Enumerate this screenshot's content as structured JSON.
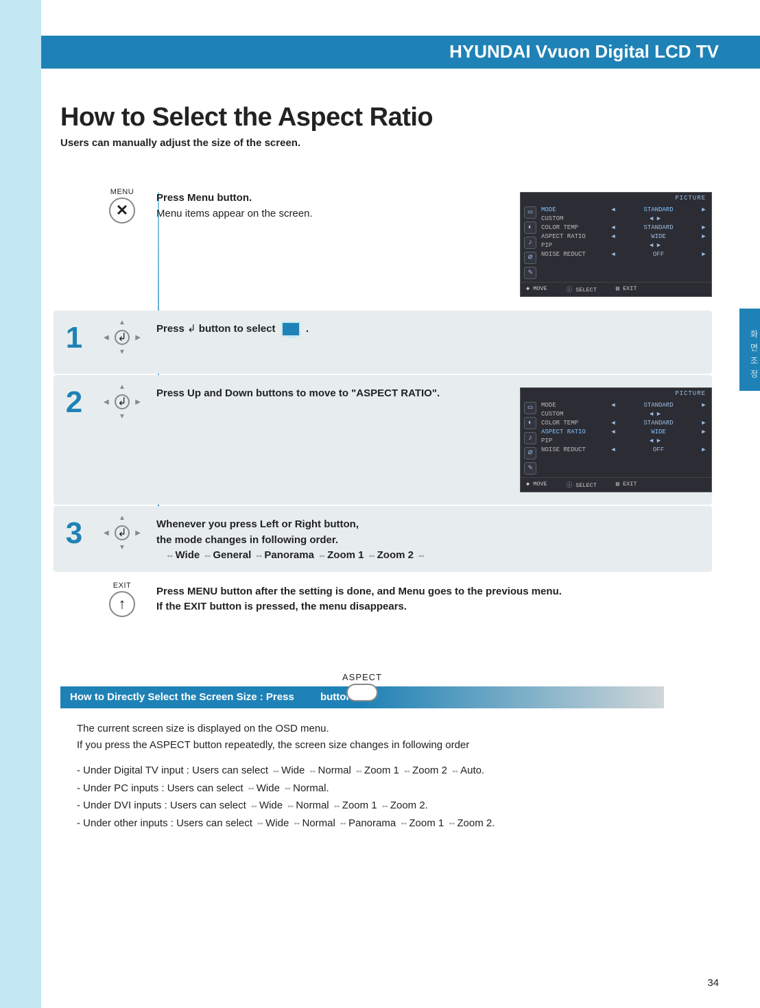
{
  "header": {
    "title": "HYUNDAI Vvuon Digital LCD TV"
  },
  "page_title": "How to Select the Aspect Ratio",
  "page_subtitle": "Users can manually adjust the size of the screen.",
  "side_tab": "화 면 조 정",
  "steps": {
    "menu": {
      "icon_label": "MENU",
      "line1": "Press Menu button.",
      "line2": "Menu items appear on the screen."
    },
    "s1": {
      "num": "1",
      "text_pre": "Press ",
      "text_mid": " button to select ",
      "text_post": " ."
    },
    "s2": {
      "num": "2",
      "text": "Press Up and Down buttons to move to  \"ASPECT RATIO\"."
    },
    "s3": {
      "num": "3",
      "line1": "Whenever you press Left or Right button,",
      "line2": "the mode changes in following order.",
      "modes": [
        "Wide",
        "General",
        "Panorama",
        "Zoom 1",
        "Zoom 2"
      ]
    },
    "exit": {
      "icon_label": "EXIT",
      "line1": "Press MENU button after the setting is done, and Menu goes to the previous menu.",
      "line2": "If the EXIT button is pressed, the menu disappears."
    }
  },
  "osd": {
    "title": "PICTURE",
    "footer": {
      "move": "MOVE",
      "select": "SELECT",
      "exit": "EXIT"
    },
    "panel1": {
      "rows": [
        {
          "lbl": "MODE",
          "val": "STANDARD",
          "hi": true,
          "arrows": true
        },
        {
          "lbl": "CUSTOM",
          "val": "◀ ▶",
          "hi": false,
          "arrows": false
        },
        {
          "lbl": "COLOR TEMP",
          "val": "STANDARD",
          "hi": false,
          "arrows": true
        },
        {
          "lbl": "ASPECT RATIO",
          "val": "WIDE",
          "hi": false,
          "arrows": true
        },
        {
          "lbl": "PIP",
          "val": "◀ ▶",
          "hi": false,
          "arrows": false
        },
        {
          "lbl": "NOISE REDUCT",
          "val": "OFF",
          "hi": false,
          "arrows": true
        }
      ]
    },
    "panel2": {
      "rows": [
        {
          "lbl": "MODE",
          "val": "STANDARD",
          "hi": false,
          "arrows": true
        },
        {
          "lbl": "CUSTOM",
          "val": "◀ ▶",
          "hi": false,
          "arrows": false
        },
        {
          "lbl": "COLOR TEMP",
          "val": "STANDARD",
          "hi": false,
          "arrows": true
        },
        {
          "lbl": "ASPECT RATIO",
          "val": "WIDE",
          "hi": true,
          "arrows": true
        },
        {
          "lbl": "PIP",
          "val": "◀ ▶",
          "hi": false,
          "arrows": false
        },
        {
          "lbl": "NOISE REDUCT",
          "val": "OFF",
          "hi": false,
          "arrows": true
        }
      ]
    }
  },
  "bottom": {
    "aspect_label": "ASPECT",
    "bar_pre": "How to Directly Select the Screen Size : Press",
    "bar_post": "button.",
    "line1": "The current screen size is displayed on the OSD menu.",
    "line2": "If you press the ASPECT button repeatedly, the screen size changes in following order",
    "bullets": [
      {
        "pre": "-  Under Digital TV input : Users can select ",
        "modes": [
          "Wide",
          "Normal",
          "Zoom 1",
          "Zoom 2",
          "Auto"
        ],
        "post": "."
      },
      {
        "pre": "-  Under PC inputs : Users can select ",
        "modes": [
          "Wide",
          "Normal"
        ],
        "post": "."
      },
      {
        "pre": "-  Under DVI inputs : Users can select ",
        "modes": [
          "Wide",
          "Normal",
          "Zoom 1",
          "Zoom 2"
        ],
        "post": "."
      },
      {
        "pre": "-  Under other inputs : Users can select ",
        "modes": [
          "Wide",
          "Normal",
          "Panorama",
          "Zoom 1",
          "Zoom 2"
        ],
        "post": "."
      }
    ]
  },
  "page_number": "34"
}
